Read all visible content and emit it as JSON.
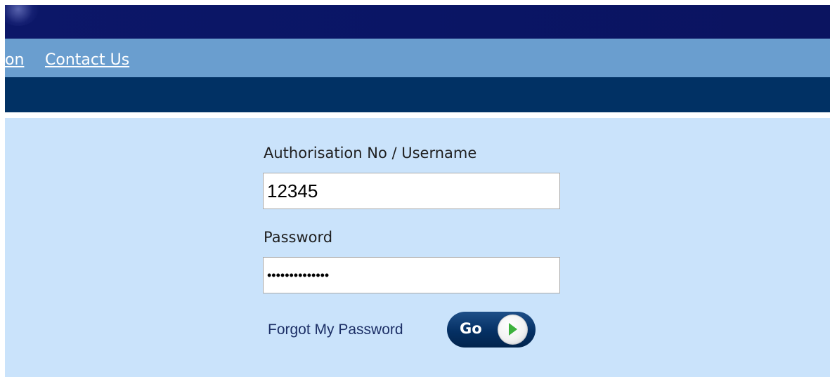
{
  "nav": {
    "partial_link": "on",
    "contact_link": "Contact Us"
  },
  "login": {
    "username_label": "Authorisation No / Username",
    "username_value": "12345",
    "password_label": "Password",
    "password_value": "••••••••••••••",
    "forgot_link": "Forgot My Password",
    "go_label": "Go",
    "go_icon": "play-arrow-icon"
  },
  "colors": {
    "banner": "#0b1566",
    "nav_bar": "#6a9ecf",
    "dark_bar": "#013164",
    "panel": "#cae3fb",
    "go_button": "#053064",
    "go_arrow": "#3cb13c"
  }
}
